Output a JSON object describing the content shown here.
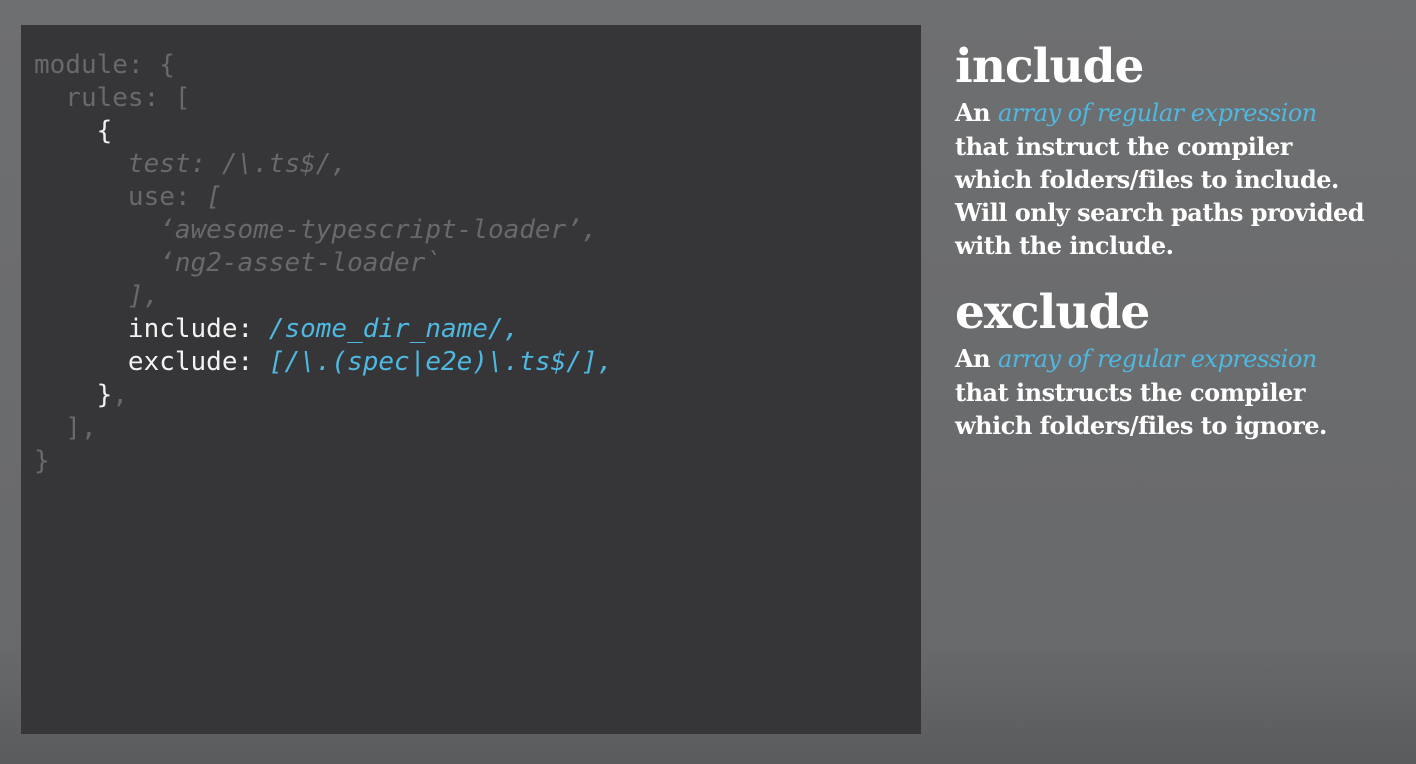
{
  "code": {
    "l1": "module: {",
    "l2": "  rules: [",
    "l3": "    {",
    "l4": "      test: /\\.ts$/,",
    "l5_key": "      use: ",
    "l5_val": "[",
    "l6": "        ‘awesome-typescript-loader’,",
    "l7": "        ‘ng2-asset-loader`",
    "l8": "      ],",
    "l9_key": "      include: ",
    "l9_val": "/some_dir_name/,",
    "l10_key": "      exclude: ",
    "l10_val": "[/\\.(spec|e2e)\\.ts$/],",
    "l11_brace": "    }",
    "l11_comma": ",",
    "l12": "  ],",
    "l13": "}"
  },
  "include": {
    "title": "include",
    "line1_a": "An ",
    "line1_hl": "array of regular expression",
    "line2": "that instruct the compiler",
    "line3": "which folders/files to include.",
    "line4": "Will only search paths provided",
    "line5": "with the include."
  },
  "exclude": {
    "title": "exclude",
    "line1_a": "An ",
    "line1_hl": "array of regular expression",
    "line2": "that instructs the compiler",
    "line3": "which folders/files to ignore."
  },
  "colors": {
    "code_bg": "#363638",
    "dim_text": "#68696b",
    "highlight": "#4fb8e0",
    "page_bg": "#6e6f71"
  }
}
